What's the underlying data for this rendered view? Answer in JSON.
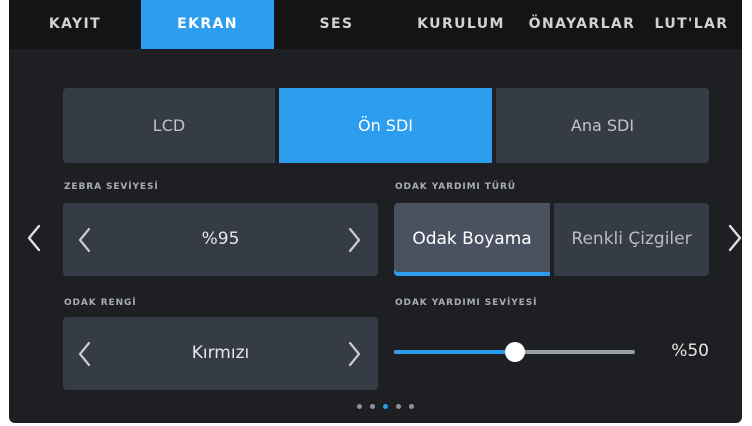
{
  "tabs": [
    {
      "label": "KAYIT",
      "active": false
    },
    {
      "label": "EKRAN",
      "active": true
    },
    {
      "label": "SES",
      "active": false
    },
    {
      "label": "KURULUM",
      "active": false
    },
    {
      "label": "ÖNAYARLAR",
      "active": false
    },
    {
      "label": "LUT'LAR",
      "active": false
    }
  ],
  "outputs": {
    "options": [
      "LCD",
      "Ön SDI",
      "Ana SDI"
    ],
    "selected": "Ön SDI"
  },
  "zebra": {
    "label": "ZEBRA SEVİYESİ",
    "value": "%95",
    "prev_icon": "chevron-left-icon",
    "next_icon": "chevron-right-icon"
  },
  "focus_assist_type": {
    "label": "ODAK YARDIMI TÜRÜ",
    "options": [
      "Odak Boyama",
      "Renkli Çizgiler"
    ],
    "selected": "Odak Boyama"
  },
  "focus_color": {
    "label": "ODAK RENGİ",
    "value": "Kırmızı",
    "prev_icon": "chevron-left-icon",
    "next_icon": "chevron-right-icon"
  },
  "focus_assist_level": {
    "label": "ODAK YARDIMI SEVİYESİ",
    "value_text": "%50",
    "level": 0.5
  },
  "pagination": {
    "pages": 5,
    "current": 3
  },
  "nav": {
    "prev_icon": "chevron-left-icon",
    "next_icon": "chevron-right-icon"
  },
  "colors": {
    "accent": "#2d9df0",
    "background": "#1e1f22",
    "tabbar": "#141416",
    "panel": "#363c46",
    "text": "#e6e6e6"
  }
}
